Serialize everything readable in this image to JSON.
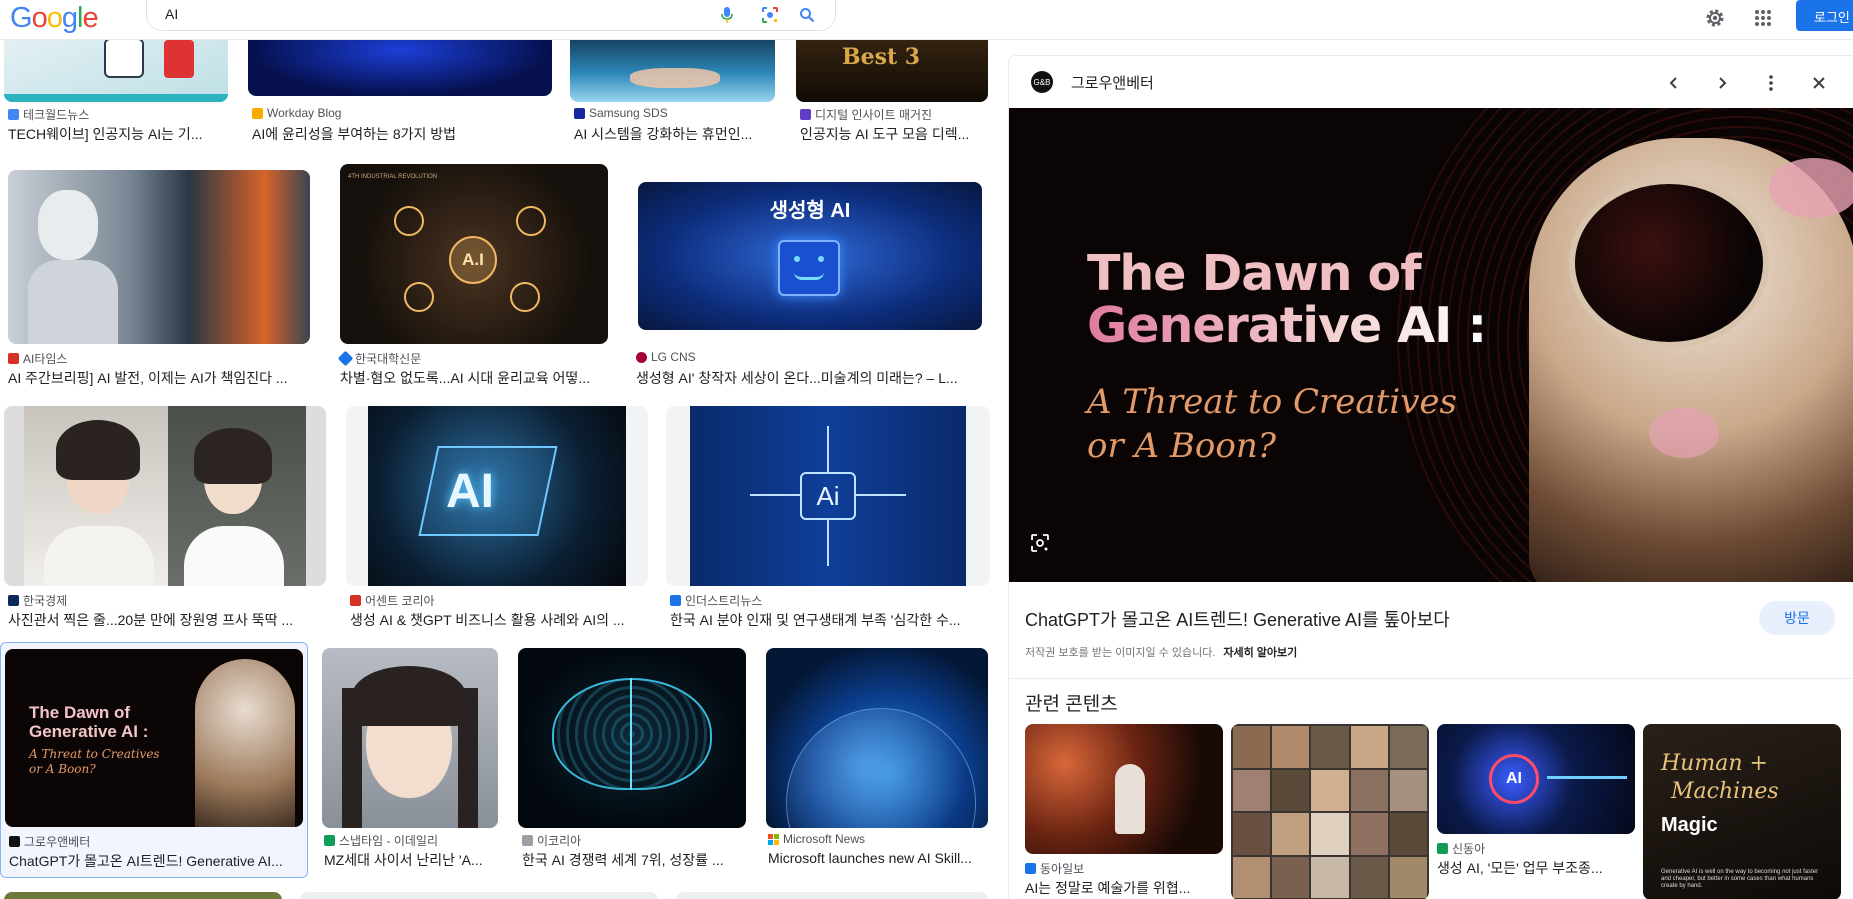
{
  "header": {
    "logo": [
      "G",
      "o",
      "o",
      "g",
      "l",
      "e"
    ],
    "search_value": "AI",
    "login_label": "로그인"
  },
  "grid": [
    {
      "source": "테크월드뉴스",
      "title": "TECH웨이브] 인공지능 AI는 기...",
      "fav": "#4285f4"
    },
    {
      "source": "Workday Blog",
      "title": "AI에 윤리성을 부여하는 8가지 방법",
      "fav": "#f9ab00"
    },
    {
      "source": "Samsung SDS",
      "title": "AI 시스템을 강화하는 휴먼인...",
      "fav": "#1428a0"
    },
    {
      "source": "디지털 인사이트 매거진",
      "title": "인공지능 AI 도구 모음 디렉...",
      "fav": "#5f3dc4"
    },
    {
      "source": "AI타임스",
      "title": "AI 주간브리핑] AI 발전, 이제는 AI가 책임진다 ...",
      "fav": "#d93025"
    },
    {
      "source": "한국대학신문",
      "title": "차별·혐오 없도록...AI 시대 윤리교육 어떻...",
      "fav": "#1a73e8"
    },
    {
      "source": "LG CNS",
      "title": "생성형 AI' 창작자 세상이 온다...미술계의 미래는? – L...",
      "fav": "#a50034"
    },
    {
      "source": "한국경제",
      "title": "사진관서 찍은 줄...20분 만에 장원영 프사 뚝딱 ...",
      "fav": "#0b2a5b"
    },
    {
      "source": "어센트 코리아",
      "title": "생성 AI & 챗GPT 비즈니스 활용 사례와 AI의 ...",
      "fav": "#d93025"
    },
    {
      "source": "인더스트리뉴스",
      "title": "한국 AI 분야 인재 및 연구생태계 부족 '심각한 수...",
      "fav": "#1a73e8"
    },
    {
      "source": "그로우앤베터",
      "title": "ChatGPT가 몰고온 AI트렌드! Generative AI...",
      "fav": "#111111"
    },
    {
      "source": "스냅타임 - 이데일리",
      "title": "MZ세대 사이서 난리난 'A...",
      "fav": "#0f9d58"
    },
    {
      "source": "이코리아",
      "title": "한국 AI 경쟁력 세계 7위, 성장률 ...",
      "fav": "#9aa0a6"
    },
    {
      "source": "Microsoft News",
      "title": "Microsoft launches new AI Skill...",
      "fav": "#f25022"
    }
  ],
  "thumb_text": {
    "gen_ai": "생성형 AI",
    "ai_big": "AI",
    "ai_small": "Ai",
    "ai_dot": "A.I",
    "best3": "Best 3",
    "industrial": "4TH INDUSTRIAL REVOLUTION",
    "mini_title": "The Dawn of Generative AI :",
    "mini_sub": "A Threat to Creatives or A Boon?"
  },
  "panel": {
    "source": "그로우앤베터",
    "fav_text": "G&B",
    "hero_title_1": "The Dawn of",
    "hero_title_2": "Generative AI :",
    "hero_sub_1": "A Threat to Creatives",
    "hero_sub_2": "or A Boon?",
    "caption": "ChatGPT가 몰고온 AI트렌드! Generative AI를 톺아보다",
    "visit_label": "방문",
    "copyright": "저작권 보호를 받는 이미지일 수 있습니다.",
    "learn_more": "자세히 알아보기",
    "related_heading": "관련 콘텐츠",
    "related": [
      {
        "source": "동아일보",
        "title": "AI는 정말로 예술가를 위협...",
        "fav": "#1a73e8"
      },
      {
        "source": "",
        "title": "",
        "fav": ""
      },
      {
        "source": "신동아",
        "title": "생성 AI, '모든' 업무 부조종...",
        "fav": "#0f9d58"
      },
      {
        "source": "",
        "title": "",
        "fav": ""
      }
    ],
    "related_text": {
      "ai_chip": "AI",
      "human_1": "Human +",
      "human_2": "Machines",
      "human_3": "Magic",
      "human_small": "Generative AI is well on the way to becoming not just faster and cheaper, but better in some cases than what humans create by hand."
    }
  }
}
